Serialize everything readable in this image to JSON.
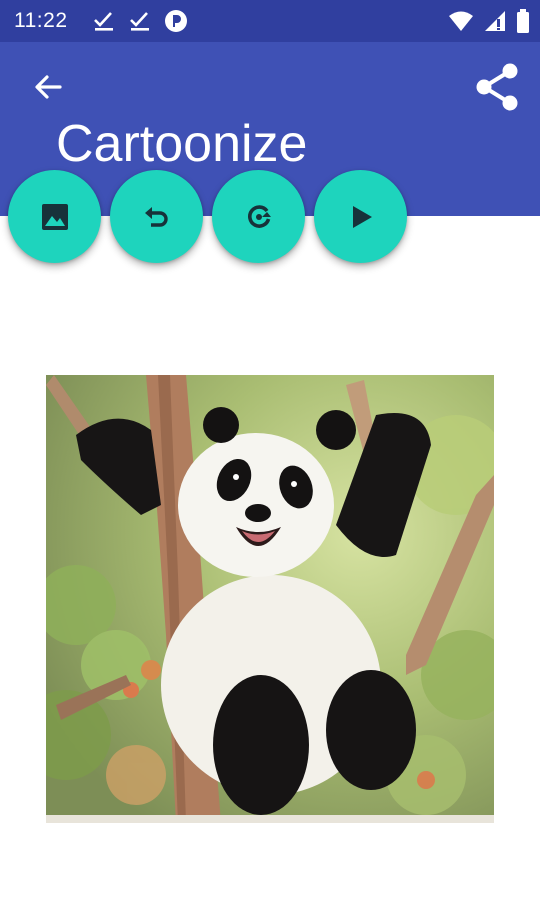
{
  "status_bar": {
    "time": "11:22",
    "left_icons": [
      "check-download-icon",
      "check-download-icon",
      "app-notification-icon"
    ],
    "right_icons": [
      "wifi-icon",
      "cellular-signal-icon",
      "battery-icon"
    ]
  },
  "app_bar": {
    "title": "Cartoonize",
    "back_icon": "arrow-back-icon",
    "share_icon": "share-icon",
    "color": "#3f51b5",
    "status_color": "#303f9f"
  },
  "actions": [
    {
      "name": "pick-image-button",
      "icon": "image-icon"
    },
    {
      "name": "undo-button",
      "icon": "undo-icon"
    },
    {
      "name": "redo-button",
      "icon": "redo-icon"
    },
    {
      "name": "run-button",
      "icon": "play-icon"
    }
  ],
  "fab_color": "#1ed4bd",
  "image": {
    "subject": "cartoonized-panda-photo"
  }
}
